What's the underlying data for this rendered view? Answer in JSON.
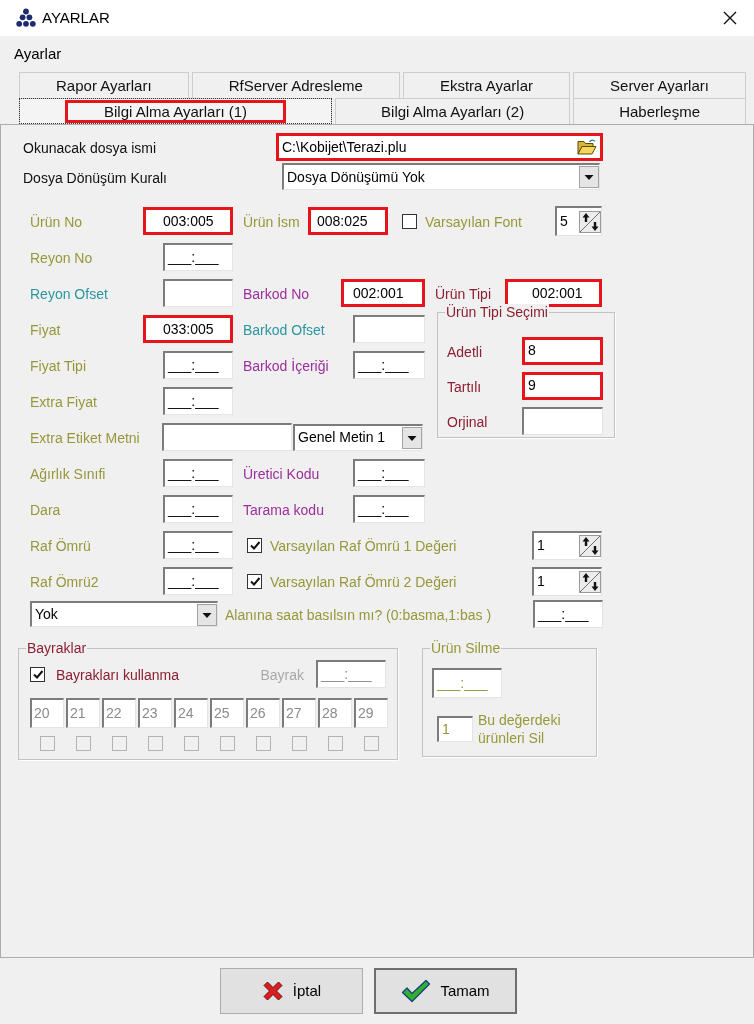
{
  "window": {
    "title": "AYARLAR"
  },
  "heading": "Ayarlar",
  "tab_rows": [
    [
      {
        "label": "Rapor Ayarları",
        "selected": false,
        "highlighted": false
      },
      {
        "label": "RfServer Adresleme",
        "selected": false,
        "highlighted": false
      },
      {
        "label": "Ekstra Ayarlar",
        "selected": false,
        "highlighted": false
      },
      {
        "label": "Server Ayarları",
        "selected": false,
        "highlighted": false
      }
    ],
    [
      {
        "label": "Bilgi Alma Ayarları (1)",
        "selected": true,
        "highlighted": true
      },
      {
        "label": "Bilgi Alma Ayarları (2)",
        "selected": false,
        "highlighted": false
      },
      {
        "label": "Haberleşme",
        "selected": false,
        "highlighted": false
      }
    ]
  ],
  "file": {
    "label": "Okunacak dosya ismi",
    "value": "C:\\Kobijet\\Terazi.plu",
    "highlighted": true
  },
  "conversion": {
    "label": "Dosya Dönüşüm Kuralı",
    "value": "Dosya Dönüşümü Yok"
  },
  "product": {
    "fields": [
      {
        "label": "Ürün No",
        "color": "#97973a",
        "value": "003:005",
        "highlighted": true
      },
      {
        "label": "Ürün İsm",
        "color": "#97973a",
        "value": "008:025",
        "highlighted": true
      }
    ],
    "default_font": {
      "label": "Varsayılan Font",
      "checked": false,
      "value": "5"
    }
  },
  "field_rows": [
    [
      {
        "kind": "field",
        "label": "Reyon No",
        "color": "#97973a",
        "value": "___:___",
        "highlighted": false
      }
    ],
    [
      {
        "kind": "field",
        "label": "Reyon Ofset",
        "color": "#2a96a0",
        "highlighted": false
      },
      {
        "kind": "field",
        "label": "Barkod No",
        "color": "#9c2f9c",
        "value": "002:001",
        "highlighted": true
      }
    ],
    [
      {
        "kind": "field",
        "label": "Fiyat",
        "color": "#97973a",
        "value": "033:005",
        "highlighted": true
      },
      {
        "kind": "field",
        "label": "Barkod Ofset",
        "color": "#2a96a0",
        "highlighted": false
      }
    ],
    [
      {
        "kind": "field",
        "label": "Fiyat Tipi",
        "color": "#97973a",
        "value": "___:___",
        "highlighted": false
      },
      {
        "kind": "field",
        "label": "Barkod İçeriği",
        "color": "#9c2f9c",
        "value": "___:___",
        "highlighted": false
      }
    ],
    [
      {
        "kind": "field",
        "label": "Extra Fiyat",
        "color": "#97973a",
        "value": "___:___",
        "highlighted": false
      }
    ],
    [
      {
        "kind": "text_with_select",
        "label": "Extra Etiket Metni",
        "color": "#97973a",
        "option": "Genel Metin 1",
        "highlighted": false
      }
    ],
    [
      {
        "kind": "field",
        "label": "Ağırlık Sınıfi",
        "color": "#97973a",
        "value": "___:___",
        "highlighted": false
      },
      {
        "kind": "field",
        "label": "Üretici Kodu",
        "color": "#9c2f9c",
        "value": "___:___",
        "highlighted": false
      }
    ],
    [
      {
        "kind": "field",
        "label": "Dara",
        "color": "#97973a",
        "value": "___:___",
        "highlighted": false
      },
      {
        "kind": "field",
        "label": "Tarama kodu",
        "color": "#9c2f9c",
        "value": "___:___",
        "highlighted": false
      }
    ]
  ],
  "product_type": {
    "label": "Ürün Tipi",
    "color": "#8c1f32",
    "value": "002:001",
    "highlighted": true
  },
  "product_type_choice": {
    "title": "Ürün Tipi Seçimi",
    "items": [
      {
        "label": "Adetli",
        "value": "8",
        "highlighted": true
      },
      {
        "label": "Tartılı",
        "value": "9",
        "highlighted": true
      },
      {
        "label": "Orjinal",
        "highlighted": false
      }
    ]
  },
  "shelf_life": [
    {
      "label": "Raf Ömrü",
      "color": "#97973a",
      "value": "___:___",
      "default": {
        "label": "Varsayılan Raf Ömrü 1 Değeri",
        "checked": true,
        "value": "1"
      }
    },
    {
      "label": "Raf Ömrü2",
      "color": "#97973a",
      "value": "___:___",
      "default": {
        "label": "Varsayılan Raf Ömrü 2 Değeri",
        "checked": true,
        "value": "1"
      }
    }
  ],
  "clock": {
    "option": "Yok",
    "label": "Alanına saat basılsın mı? (0:basma,1:bas )",
    "value": "___:___"
  },
  "flags": {
    "title": "Bayraklar",
    "use_flags": {
      "label": "Bayrakları kullanma",
      "checked": true
    },
    "flag": {
      "label": "Bayrak",
      "value": "___:___",
      "disabled": true
    },
    "items": [
      {
        "value": "20",
        "checked": false,
        "disabled": true
      },
      {
        "value": "21",
        "checked": false,
        "disabled": true
      },
      {
        "value": "22",
        "checked": false,
        "disabled": true
      },
      {
        "value": "23",
        "checked": false,
        "disabled": true
      },
      {
        "value": "24",
        "checked": false,
        "disabled": true
      },
      {
        "value": "25",
        "checked": false,
        "disabled": true
      },
      {
        "value": "26",
        "checked": false,
        "disabled": true
      },
      {
        "value": "27",
        "checked": false,
        "disabled": true
      },
      {
        "value": "28",
        "checked": false,
        "disabled": true
      },
      {
        "value": "29",
        "checked": false,
        "disabled": true
      }
    ]
  },
  "product_delete": {
    "title": "Ürün Silme",
    "value": "___:___",
    "count": "1",
    "label": "Bu değerdeki ürünleri Sil"
  },
  "buttons": [
    {
      "kind": "cancel",
      "label": "İptal",
      "default": false
    },
    {
      "kind": "ok",
      "label": "Tamam",
      "default": true
    }
  ]
}
